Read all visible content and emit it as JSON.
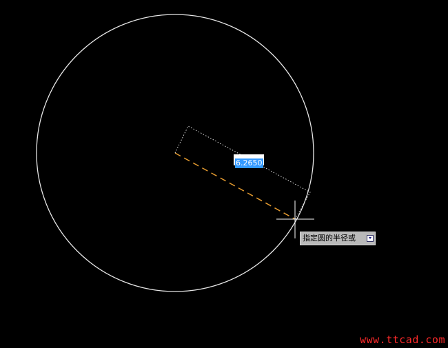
{
  "drawing": {
    "dimension_value": "6.2650",
    "prompt_text": "指定圆的半径或",
    "colors": {
      "background": "#000000",
      "circle": "#e6e6e6",
      "radius_line": "#e39a2f",
      "dim_outline": "#dcdcdc",
      "selection": "#3399ff"
    }
  },
  "watermark": {
    "text": "www.ttcad.com"
  }
}
